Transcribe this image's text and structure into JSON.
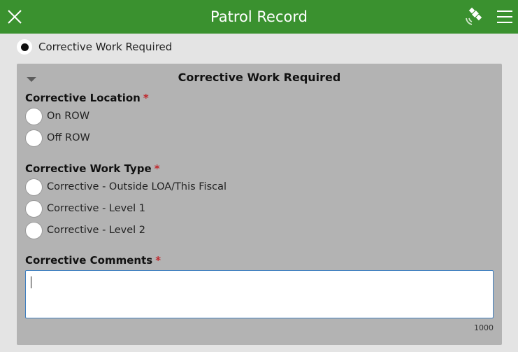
{
  "header": {
    "title": "Patrol Record",
    "background": "#3a912f",
    "close_icon": "close-icon",
    "gps_icon": "satellite-icon",
    "menu_icon": "menu-icon"
  },
  "top_radio": {
    "label": "Corrective Work Required",
    "selected": true
  },
  "group": {
    "title": "Corrective Work Required",
    "collapsed": false,
    "fields": {
      "location": {
        "label": "Corrective Location",
        "required_mark": "*",
        "options": [
          "On ROW",
          "Off ROW"
        ]
      },
      "work_type": {
        "label": "Corrective Work Type",
        "required_mark": "*",
        "options": [
          "Corrective - Outside LOA/This Fiscal",
          "Corrective - Level 1",
          "Corrective - Level 2"
        ]
      },
      "comments": {
        "label": "Corrective Comments",
        "required_mark": "*",
        "value": "",
        "max_length": "1000"
      }
    }
  }
}
